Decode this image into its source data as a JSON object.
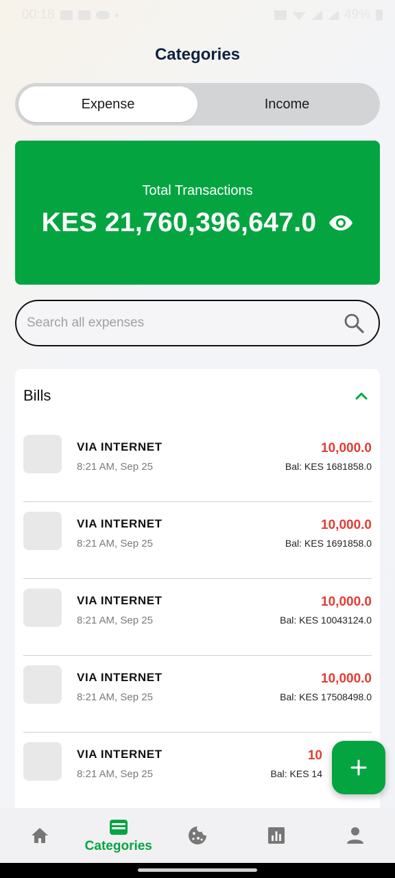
{
  "status_bar": {
    "time": "00:18",
    "battery": "49%"
  },
  "header": {
    "title": "Categories"
  },
  "tabs": [
    {
      "label": "Expense",
      "active": true
    },
    {
      "label": "Income",
      "active": false
    }
  ],
  "summary": {
    "label": "Total Transactions",
    "amount": "KES 21,760,396,647.0"
  },
  "search": {
    "placeholder": "Search all expenses",
    "value": ""
  },
  "group": {
    "title": "Bills",
    "transactions": [
      {
        "name": "VIA INTERNET",
        "time": "8:21 AM, Sep 25",
        "amount": "10,000.0",
        "balance": "Bal: KES 1681858.0"
      },
      {
        "name": "VIA INTERNET",
        "time": "8:21 AM, Sep 25",
        "amount": "10,000.0",
        "balance": "Bal: KES 1691858.0"
      },
      {
        "name": "VIA INTERNET",
        "time": "8:21 AM, Sep 25",
        "amount": "10,000.0",
        "balance": "Bal: KES 10043124.0"
      },
      {
        "name": "VIA INTERNET",
        "time": "8:21 AM, Sep 25",
        "amount": "10,000.0",
        "balance": "Bal: KES 17508498.0"
      },
      {
        "name": "VIA INTERNET",
        "time": "8:21 AM, Sep 25",
        "amount": "10",
        "balance": "Bal: KES 14"
      }
    ]
  },
  "bottom_nav": {
    "items": [
      {
        "icon": "home-icon",
        "label": ""
      },
      {
        "icon": "wallet-icon",
        "label": "Categories",
        "active": true
      },
      {
        "icon": "cookie-icon",
        "label": ""
      },
      {
        "icon": "bar-chart-icon",
        "label": ""
      },
      {
        "icon": "person-icon",
        "label": ""
      }
    ]
  },
  "colors": {
    "accent": "#04a541",
    "expense_red": "#e43c35",
    "title_navy": "#0f2140"
  }
}
